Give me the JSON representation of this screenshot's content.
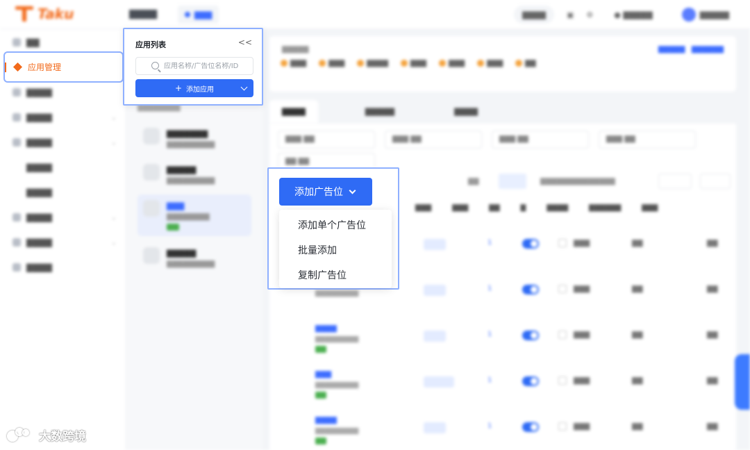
{
  "colors": {
    "accent": "#2f6bf5",
    "brand": "#f26a1b",
    "highlight_border": "#8fb0ff",
    "success": "#4caf50"
  },
  "brand": {
    "logo_text": "Taku"
  },
  "sidebar": {
    "active_item": "应用管理"
  },
  "app_list": {
    "title": "应用列表",
    "collapse_label": "<<",
    "search_placeholder": "应用名称/广告位名称/ID",
    "add_button_label": "添加应用"
  },
  "add_slot": {
    "button_label": "添加广告位",
    "menu": [
      "添加单个广告位",
      "批量添加",
      "复制广告位"
    ]
  },
  "watermark": {
    "text": "大数跨境"
  }
}
